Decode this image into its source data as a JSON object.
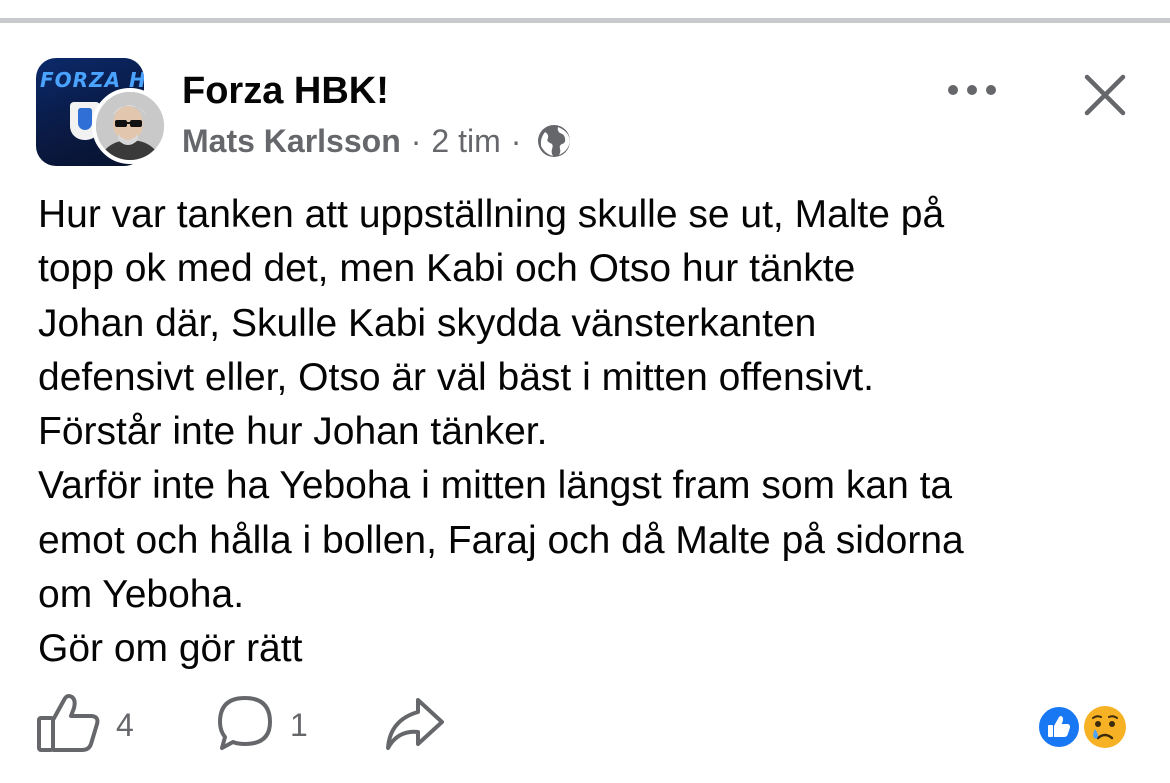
{
  "post": {
    "group_name": "Forza HBK!",
    "author": "Mats Karlsson",
    "separator": "·",
    "time": "2 tim",
    "privacy_icon": "globe-icon",
    "body_lines": [
      "Hur var tanken att uppställning skulle se ut, Malte på",
      "topp ok med det, men Kabi och Otso hur tänkte",
      "Johan där, Skulle Kabi skydda vänsterkanten",
      "defensivt eller, Otso är väl bäst i mitten offensivt.",
      "Förstår inte hur Johan tänker.",
      "Varför inte ha Yeboha i mitten längst fram som kan ta",
      "emot och hålla i bollen, Faraj och då Malte på sidorna",
      "om Yeboha.",
      "Gör om gör rätt"
    ]
  },
  "group_avatar": {
    "logo_text": "FORZA HBK"
  },
  "actions": {
    "like_count": "4",
    "comment_count": "1"
  },
  "reactions": [
    "like",
    "sad"
  ],
  "colors": {
    "text": "#050505",
    "secondary_text": "#65676b",
    "like_blue": "#1877f2",
    "divider": "#c8c9cc"
  }
}
